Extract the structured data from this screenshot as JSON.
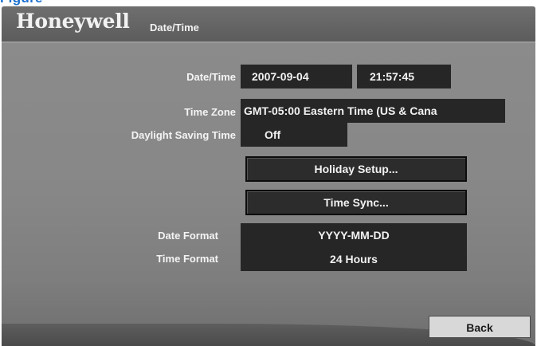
{
  "top_caption": "Figure",
  "header": {
    "brand": "Honeywell",
    "title": "Date/Time"
  },
  "form": {
    "datetime_label": "Date/Time",
    "date_value": "2007-09-04",
    "time_value": "21:57:45",
    "timezone_label": "Time Zone",
    "timezone_value": "GMT-05:00  Eastern Time (US & Cana",
    "dst_label": "Daylight Saving Time",
    "dst_value": "Off",
    "holiday_button": "Holiday Setup...",
    "timesync_button": "Time Sync...",
    "date_format_label": "Date Format",
    "date_format_value": "YYYY-MM-DD",
    "time_format_label": "Time Format",
    "time_format_value": "24 Hours"
  },
  "footer": {
    "back_label": "Back"
  }
}
